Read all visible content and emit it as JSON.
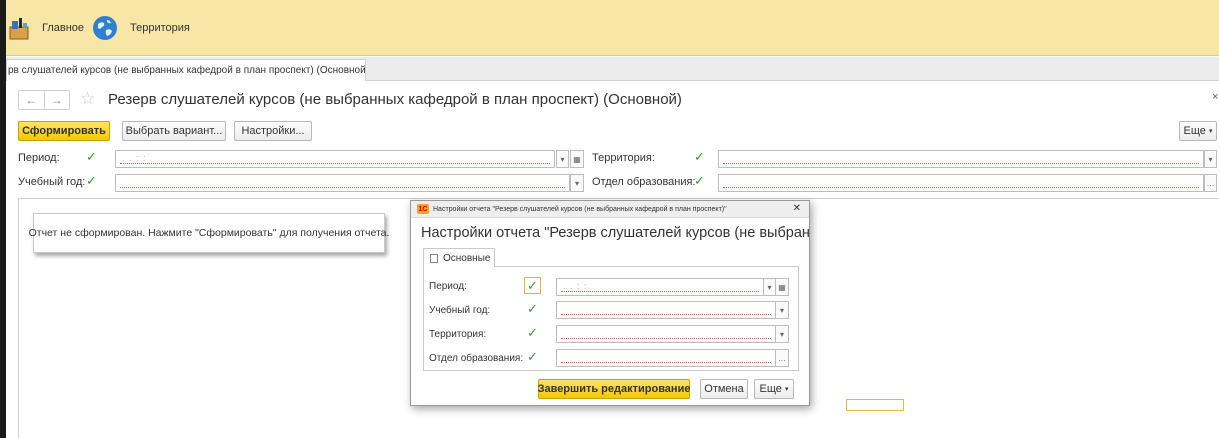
{
  "top_panel": {
    "sections": [
      {
        "label": "Главное",
        "icon": "home-sections-icon"
      },
      {
        "label": "Территория",
        "icon": "globe-icon"
      }
    ]
  },
  "tabs": [
    {
      "label": "рв слушателей курсов (не выбранных кафедрой в план проспект) (Основной)",
      "close": "×"
    }
  ],
  "header": {
    "back": "←",
    "forward": "→",
    "title": "Резерв слушателей курсов (не выбранных кафедрой в план проспект) (Основной)",
    "close": "×"
  },
  "toolbar": {
    "generate_label": "Сформировать",
    "select_variant_label": "Выбрать вариант...",
    "settings_label": "Настройки...",
    "more_label": "Еще"
  },
  "filters": {
    "period_label": "Период:",
    "period_mask": ". .   : :",
    "territory_label": "Территория:",
    "study_year_label": "Учебный год:",
    "education_dept_label": "Отдел образования:"
  },
  "report": {
    "notice": "Отчет не сформирован. Нажмите \"Сформировать\" для получения отчета."
  },
  "dialog": {
    "window_title": "Настройки отчета \"Резерв слушателей курсов (не выбранных кафедрой в план проспект)\"",
    "heading": "Настройки отчета \"Резерв слушателей курсов (не выбранных кафедрой в план проспект)\"",
    "tab_label": "Основные",
    "fields": {
      "period_label": "Период:",
      "period_mask": ". .   : :",
      "study_year_label": "Учебный год:",
      "territory_label": "Территория:",
      "education_dept_label": "Отдел образования:"
    },
    "finish_label": "Завершить редактирование",
    "cancel_label": "Отмена",
    "more_label": "Еще"
  },
  "colors": {
    "top_panel": "#f7e6a6",
    "primary_button": "#f5c800",
    "check_green": "#3a9a3a",
    "required_underline": "#d9534f"
  }
}
